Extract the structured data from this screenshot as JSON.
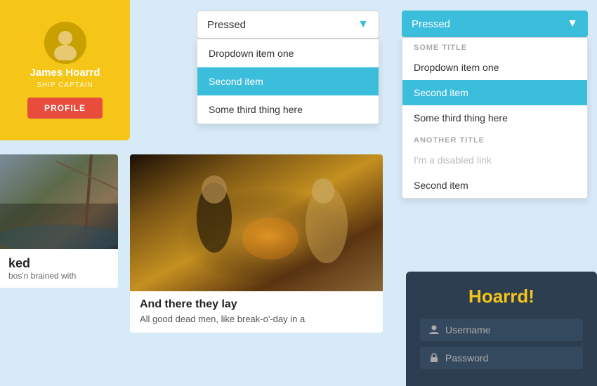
{
  "profile": {
    "name": "James Hoarrd",
    "title": "SHIP CAPTAIN",
    "button_label": "PROFILE"
  },
  "dropdown_simple": {
    "selected": "Pressed",
    "items": [
      {
        "label": "Dropdown item one",
        "active": false
      },
      {
        "label": "Second item",
        "active": true
      },
      {
        "label": "Some third thing here",
        "active": false
      }
    ]
  },
  "dropdown_sectioned": {
    "selected": "Pressed",
    "sections": [
      {
        "title": "SOME TITLE",
        "items": [
          {
            "label": "Dropdown item one",
            "active": false,
            "disabled": false
          },
          {
            "label": "Second item",
            "active": true,
            "disabled": false
          },
          {
            "label": "Some third thing here",
            "active": false,
            "disabled": false
          }
        ]
      },
      {
        "title": "ANOTHER TITLE",
        "items": [
          {
            "label": "I'm a disabled link",
            "active": false,
            "disabled": true
          },
          {
            "label": "Second item",
            "active": false,
            "disabled": false
          }
        ]
      }
    ]
  },
  "cards": [
    {
      "cut_tag": "ked",
      "cut_sub": "bos'n brained with"
    },
    {
      "title": "And there they lay",
      "text": "All good dead men, like break-o'-day in a"
    }
  ],
  "login": {
    "title": "Hoarrd!",
    "username_placeholder": "Username",
    "password_placeholder": "Password"
  }
}
